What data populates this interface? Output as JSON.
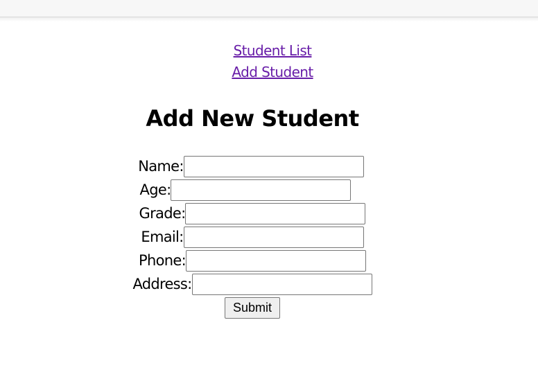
{
  "nav": {
    "student_list": "Student List",
    "add_student": "Add Student"
  },
  "page": {
    "title": "Add New Student"
  },
  "form": {
    "fields": {
      "name": {
        "label": "Name:",
        "value": ""
      },
      "age": {
        "label": "Age:",
        "value": ""
      },
      "grade": {
        "label": "Grade:",
        "value": ""
      },
      "email": {
        "label": "Email:",
        "value": ""
      },
      "phone": {
        "label": "Phone:",
        "value": ""
      },
      "address": {
        "label": "Address:",
        "value": ""
      }
    },
    "submit_label": "Submit"
  },
  "colors": {
    "link": "#681da8",
    "background": "#ffffff",
    "input_border": "#767676"
  }
}
